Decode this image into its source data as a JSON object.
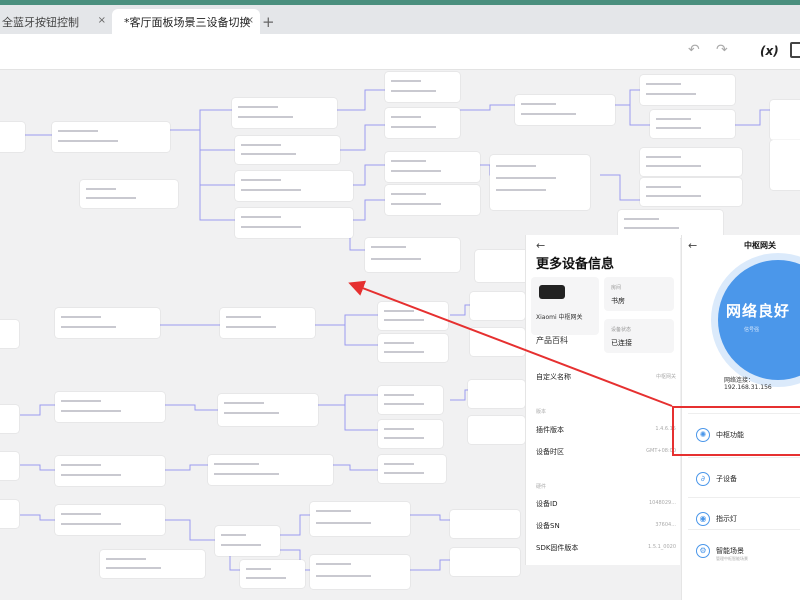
{
  "tabs": [
    {
      "label": "全蓝牙按钮控制",
      "close": "×"
    },
    {
      "label": "*客厅面板场景三设备切换",
      "close": "×"
    }
  ],
  "tab_add": "+",
  "toolbar": {
    "undo": "↶",
    "redo": "↷",
    "fx": "(x)"
  },
  "info_panel": {
    "back": "←",
    "title": "更多设备信息",
    "device_name": "Xiaomi 中枢网关",
    "room": {
      "key": "房间",
      "value": "书房"
    },
    "status": {
      "key": "设备状态",
      "value": "已连接"
    },
    "product_link": "产品百科",
    "rows": [
      {
        "label": "自定义名称",
        "value": "中枢网关"
      }
    ],
    "sections": [
      {
        "header": "版本",
        "rows": [
          {
            "label": "插件版本",
            "value": "1.4.6.15"
          },
          {
            "label": "设备时区",
            "value": "GMT+08:00"
          }
        ]
      },
      {
        "header": "硬件",
        "rows": [
          {
            "label": "设备ID",
            "value": "1048029..."
          },
          {
            "label": "设备SN",
            "value": "37604..."
          },
          {
            "label": "SDK固件版本",
            "value": "1.5.1_0020"
          }
        ]
      }
    ]
  },
  "gw_panel": {
    "back": "←",
    "title": "中枢网关",
    "status": "网络良好",
    "status_sub": "信号强",
    "ip": "网络连接：192.168.31.156",
    "items": [
      {
        "icon": "✺",
        "label": "中枢功能",
        "desc": ""
      },
      {
        "icon": "∂",
        "label": "子设备",
        "desc": ""
      },
      {
        "icon": "◉",
        "label": "指示灯",
        "desc": ""
      },
      {
        "icon": "⚙",
        "label": "智能场景",
        "desc": "管理中枢智能场景"
      }
    ]
  }
}
